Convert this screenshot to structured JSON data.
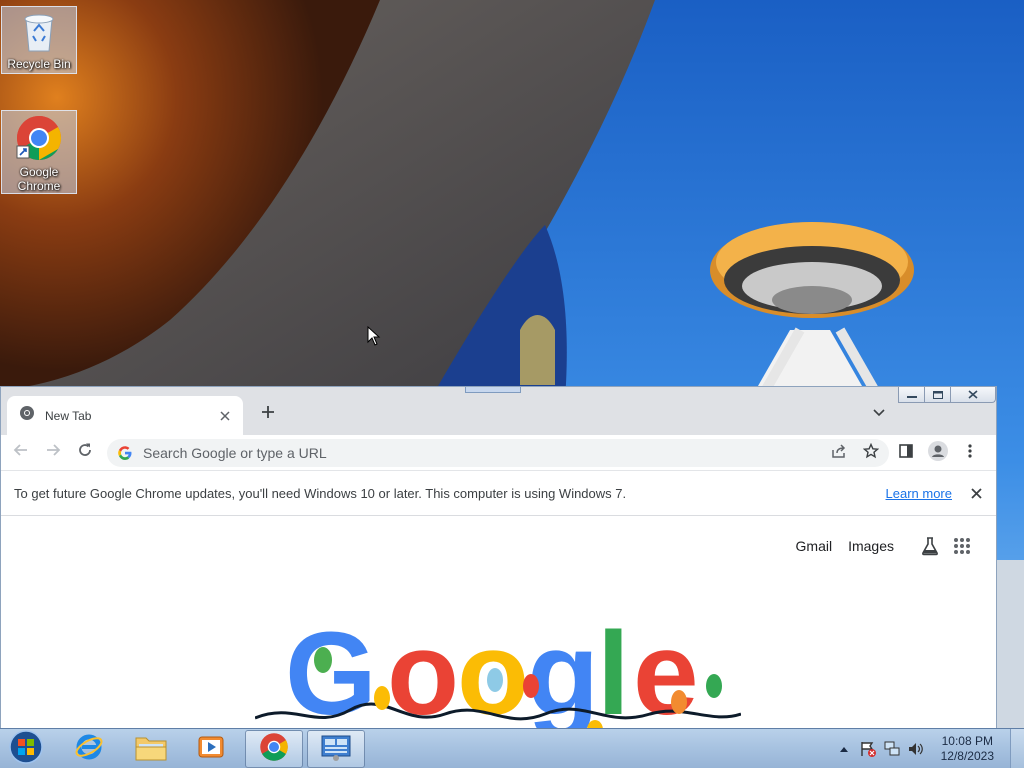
{
  "desktop": {
    "icons": [
      {
        "label": "Recycle Bin",
        "icon": "recycle-bin-icon"
      },
      {
        "label": "Google Chrome",
        "icon": "chrome-icon"
      }
    ]
  },
  "browser": {
    "tab": {
      "title": "New Tab"
    },
    "omnibox": {
      "placeholder": "Search Google or type a URL"
    },
    "infobar": {
      "message": "To get future Google Chrome updates, you'll need Windows 10 or later. This computer is using Windows 7.",
      "link": "Learn more"
    },
    "ntp": {
      "links": [
        "Gmail",
        "Images"
      ],
      "doodle_text": "Google"
    }
  },
  "taskbar": {
    "items": [
      {
        "name": "internet-explorer",
        "icon": "internet-explorer-icon"
      },
      {
        "name": "file-explorer",
        "icon": "folder-icon"
      },
      {
        "name": "media-player",
        "icon": "media-player-icon"
      },
      {
        "name": "chrome",
        "icon": "chrome-icon",
        "active": true
      },
      {
        "name": "control-panel",
        "icon": "control-panel-icon"
      }
    ],
    "clock": {
      "time": "10:08 PM",
      "date": "12/8/2023"
    }
  },
  "colors": {
    "chrome_blue": "#1a73e8",
    "taskbar_top": "#b9d1ea",
    "sky": "#1e6fd0"
  }
}
